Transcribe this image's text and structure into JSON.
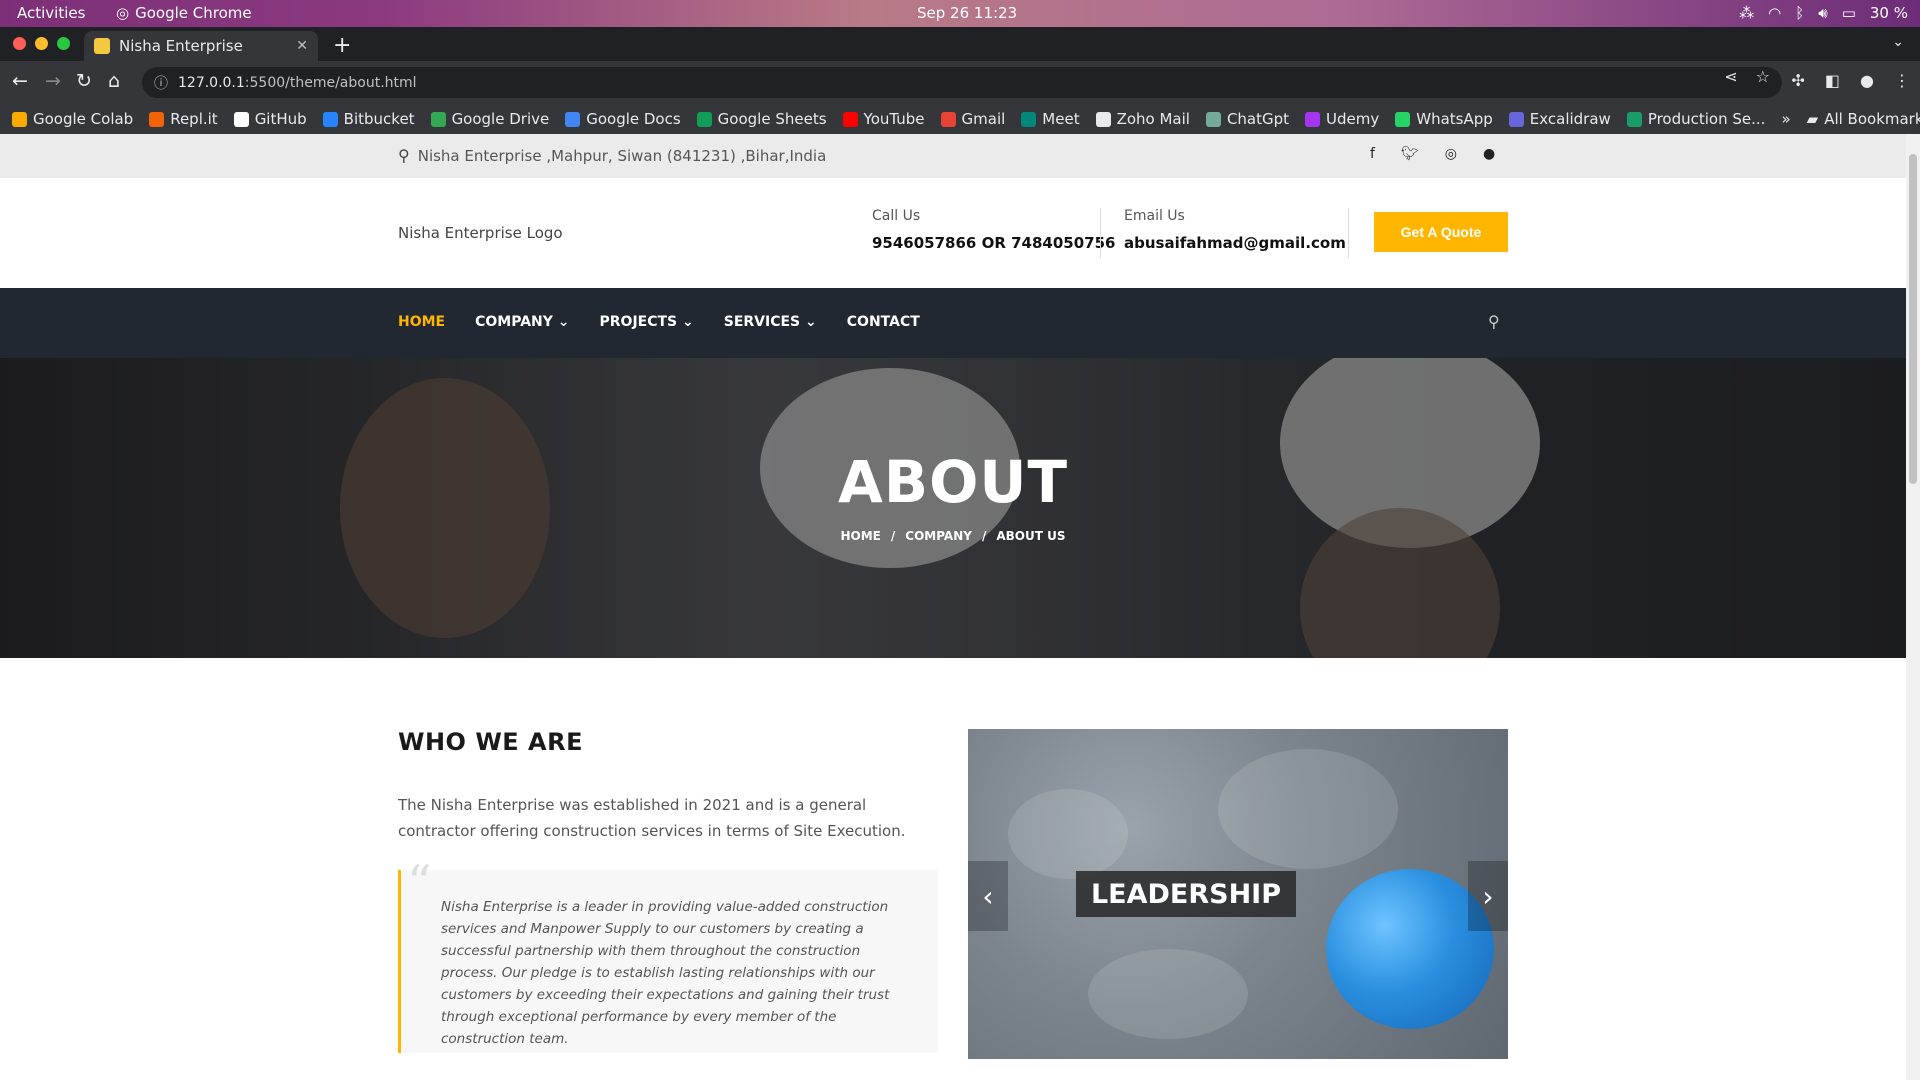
{
  "os": {
    "activities": "Activities",
    "app": "Google Chrome",
    "clock": "Sep 26  11:23",
    "battery": "30 %"
  },
  "browser": {
    "tab_title": "Nisha Enterprise",
    "url_host": "127.0.0.1",
    "url_path": ":5500/theme/about.html",
    "bookmarks": [
      {
        "label": "Google Colab",
        "color": "#f9ab00"
      },
      {
        "label": "Repl.it",
        "color": "#f26207"
      },
      {
        "label": "GitHub",
        "color": "#ffffff"
      },
      {
        "label": "Bitbucket",
        "color": "#2684ff"
      },
      {
        "label": "Google Drive",
        "color": "#34a853"
      },
      {
        "label": "Google Docs",
        "color": "#4285f4"
      },
      {
        "label": "Google Sheets",
        "color": "#0f9d58"
      },
      {
        "label": "YouTube",
        "color": "#ff0000"
      },
      {
        "label": "Gmail",
        "color": "#ea4335"
      },
      {
        "label": "Meet",
        "color": "#00897b"
      },
      {
        "label": "Zoho Mail",
        "color": "#e8eaed"
      },
      {
        "label": "ChatGpt",
        "color": "#74aa9c"
      },
      {
        "label": "Udemy",
        "color": "#a435f0"
      },
      {
        "label": "WhatsApp",
        "color": "#25d366"
      },
      {
        "label": "Excalidraw",
        "color": "#6965db"
      },
      {
        "label": "Production Se...",
        "color": "#1a9b6a"
      }
    ],
    "more_bookmarks": "»",
    "all_bookmarks": "All Bookmarks"
  },
  "site": {
    "top_address": "Nisha Enterprise ,Mahpur, Siwan (841231) ,Bihar,India",
    "social": [
      "facebook-icon",
      "twitter-icon",
      "instagram-icon",
      "github-icon"
    ],
    "logo": "Nisha Enterprise Logo",
    "call_label": "Call Us",
    "call_value": "9546057866 OR 7484050756",
    "email_label": "Email Us",
    "email_value": "abusaifahmad@gmail.com",
    "quote_button": "Get A Quote",
    "nav": {
      "home": "HOME",
      "company": "COMPANY",
      "projects": "PROJECTS",
      "services": "SERVICES",
      "contact": "CONTACT"
    },
    "hero_title": "ABOUT",
    "breadcrumb": {
      "home": "HOME",
      "company": "COMPANY",
      "current": "ABOUT US",
      "separator": "/"
    },
    "who_title": "WHO WE ARE",
    "who_text": "The Nisha Enterprise was established in 2021 and is a general contractor offering construction services in terms of Site Execution.",
    "quote": "Nisha Enterprise is a leader in providing value-added construction services and Manpower Supply to our customers by creating a successful partnership with them throughout the construction process. Our pledge is to establish lasting relationships with our customers by exceeding their expectations and gaining their trust through exceptional performance by every member of the construction team.",
    "slide_caption": "LEADERSHIP",
    "accent_color": "#ffb600"
  }
}
